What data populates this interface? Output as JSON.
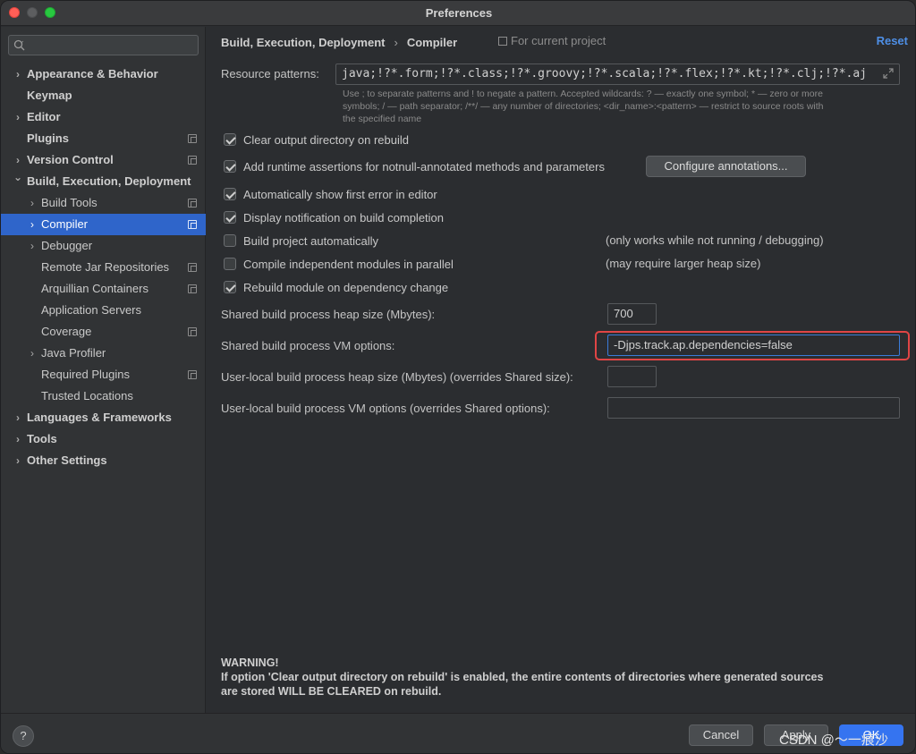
{
  "window": {
    "title": "Preferences"
  },
  "sidebar": {
    "search": {
      "placeholder": ""
    },
    "items": [
      {
        "label": "Appearance & Behavior",
        "level": 0,
        "arrow": "right",
        "bold": true,
        "copy": false,
        "selected": false
      },
      {
        "label": "Keymap",
        "level": 0,
        "arrow": "",
        "bold": true,
        "copy": false,
        "selected": false
      },
      {
        "label": "Editor",
        "level": 0,
        "arrow": "right",
        "bold": true,
        "copy": false,
        "selected": false
      },
      {
        "label": "Plugins",
        "level": 0,
        "arrow": "",
        "bold": true,
        "copy": true,
        "selected": false
      },
      {
        "label": "Version Control",
        "level": 0,
        "arrow": "right",
        "bold": true,
        "copy": true,
        "selected": false
      },
      {
        "label": "Build, Execution, Deployment",
        "level": 0,
        "arrow": "down",
        "bold": true,
        "copy": false,
        "selected": false
      },
      {
        "label": "Build Tools",
        "level": 1,
        "arrow": "right",
        "bold": false,
        "copy": true,
        "selected": false
      },
      {
        "label": "Compiler",
        "level": 1,
        "arrow": "right",
        "bold": false,
        "copy": true,
        "selected": true
      },
      {
        "label": "Debugger",
        "level": 1,
        "arrow": "right",
        "bold": false,
        "copy": false,
        "selected": false
      },
      {
        "label": "Remote Jar Repositories",
        "level": 1,
        "arrow": "",
        "bold": false,
        "copy": true,
        "selected": false
      },
      {
        "label": "Arquillian Containers",
        "level": 1,
        "arrow": "",
        "bold": false,
        "copy": true,
        "selected": false
      },
      {
        "label": "Application Servers",
        "level": 1,
        "arrow": "",
        "bold": false,
        "copy": false,
        "selected": false
      },
      {
        "label": "Coverage",
        "level": 1,
        "arrow": "",
        "bold": false,
        "copy": true,
        "selected": false
      },
      {
        "label": "Java Profiler",
        "level": 1,
        "arrow": "right",
        "bold": false,
        "copy": false,
        "selected": false
      },
      {
        "label": "Required Plugins",
        "level": 1,
        "arrow": "",
        "bold": false,
        "copy": true,
        "selected": false
      },
      {
        "label": "Trusted Locations",
        "level": 1,
        "arrow": "",
        "bold": false,
        "copy": false,
        "selected": false
      },
      {
        "label": "Languages & Frameworks",
        "level": 0,
        "arrow": "right",
        "bold": true,
        "copy": false,
        "selected": false
      },
      {
        "label": "Tools",
        "level": 0,
        "arrow": "right",
        "bold": true,
        "copy": false,
        "selected": false
      },
      {
        "label": "Other Settings",
        "level": 0,
        "arrow": "right",
        "bold": true,
        "copy": false,
        "selected": false
      }
    ]
  },
  "header": {
    "breadcrumb_parent": "Build, Execution, Deployment",
    "breadcrumb_sep": "›",
    "breadcrumb_current": "Compiler",
    "scope": "For current project",
    "reset": "Reset"
  },
  "compiler": {
    "resource_patterns_label": "Resource patterns:",
    "resource_patterns_value": "!?*.java;!?*.form;!?*.class;!?*.groovy;!?*.scala;!?*.flex;!?*.kt;!?*.clj;!?*.aj",
    "resource_patterns_display": "java;!?*.form;!?*.class;!?*.groovy;!?*.scala;!?*.flex;!?*.kt;!?*.clj;!?*.aj",
    "hint_line1": "Use ; to separate patterns and ! to negate a pattern. Accepted wildcards: ? — exactly one symbol; * — zero or more",
    "hint_line2": "symbols; / — path separator; /**/ — any number of directories; <dir_name>:<pattern> — restrict to source roots with",
    "hint_line3": "the specified name",
    "checkboxes": [
      {
        "label": "Clear output directory on rebuild",
        "checked": true,
        "note": ""
      },
      {
        "label": "Add runtime assertions for notnull-annotated methods and parameters",
        "checked": true,
        "note": ""
      },
      {
        "label": "Automatically show first error in editor",
        "checked": true,
        "note": ""
      },
      {
        "label": "Display notification on build completion",
        "checked": true,
        "note": ""
      },
      {
        "label": "Build project automatically",
        "checked": false,
        "note": "(only works while not running / debugging)"
      },
      {
        "label": "Compile independent modules in parallel",
        "checked": false,
        "note": "(may require larger heap size)"
      },
      {
        "label": "Rebuild module on dependency change",
        "checked": true,
        "note": ""
      }
    ],
    "configure_annotations": "Configure annotations...",
    "shared_heap_label": "Shared build process heap size (Mbytes):",
    "shared_heap_value": "700",
    "shared_vm_label": "Shared build process VM options:",
    "shared_vm_value": "-Djps.track.ap.dependencies=false",
    "local_heap_label": "User-local build process heap size (Mbytes) (overrides Shared size):",
    "local_heap_value": "",
    "local_vm_label": "User-local build process VM options (overrides Shared options):",
    "local_vm_value": "",
    "warning_title": "WARNING!",
    "warning_line1": "If option 'Clear output directory on rebuild' is enabled, the entire contents of directories where generated sources",
    "warning_line2": "are stored WILL BE CLEARED on rebuild."
  },
  "footer": {
    "help": "?",
    "cancel": "Cancel",
    "apply": "Apply",
    "ok": "OK",
    "watermark": "CSDN @～一痕沙"
  }
}
